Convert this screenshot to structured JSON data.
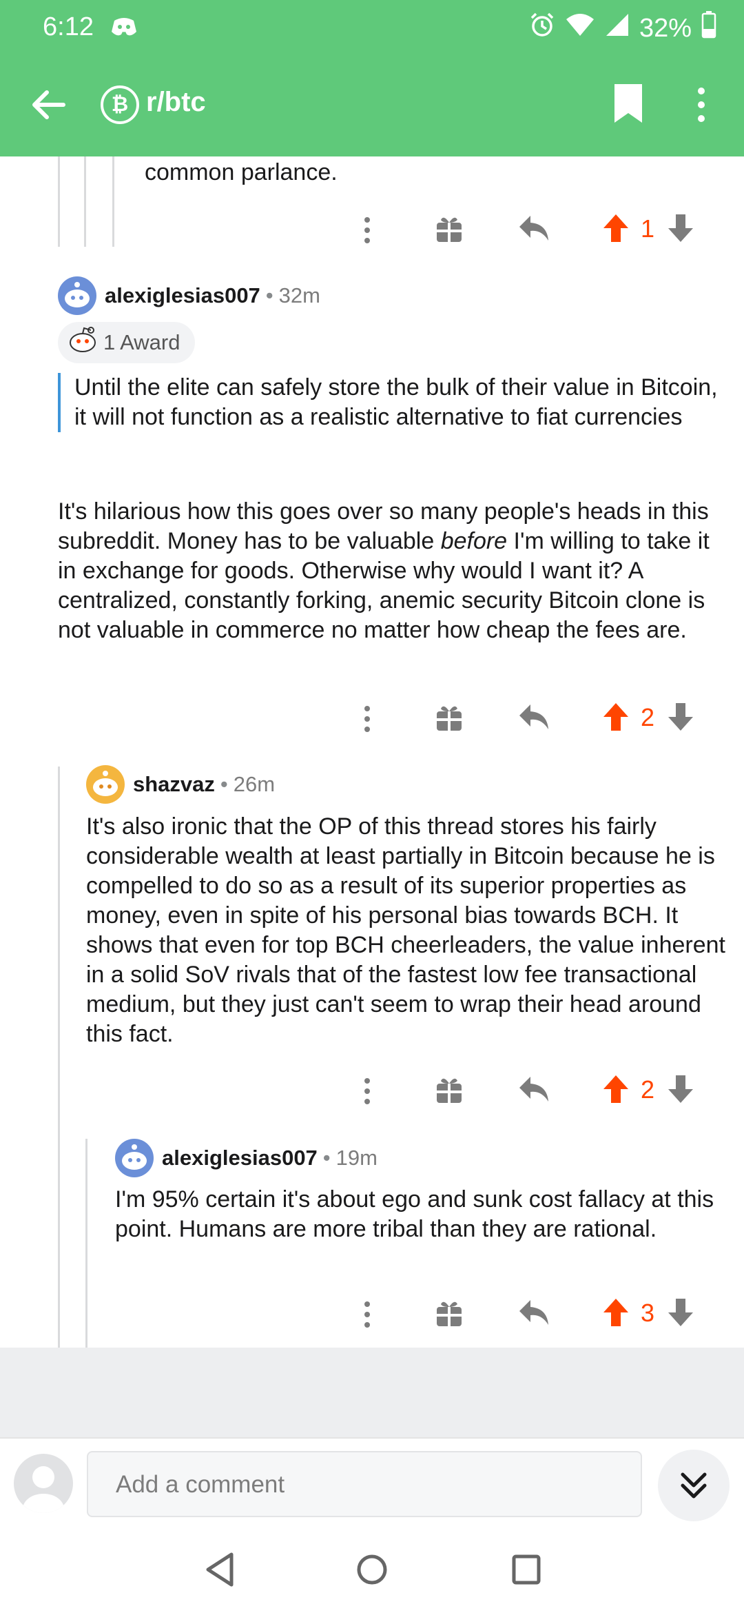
{
  "status_bar": {
    "time": "6:12",
    "battery": "32%"
  },
  "app_bar": {
    "subreddit": "r/btc"
  },
  "comments": [
    {
      "score": "1"
    },
    {
      "author": "alexiglesias007",
      "age": "32m",
      "award": "1 Award",
      "quote": "Until the elite can safely store the bulk of their value in Bitcoin, it will not function as a realistic alternative to fiat currencies",
      "body_part1": "It's hilarious how this goes over so many people's heads in this subreddit. Money has to be valuable ",
      "body_emphasis": "before",
      "body_part2": " I'm willing to take it in exchange for goods. Otherwise why would I want it? A centralized, constantly forking, anemic security Bitcoin clone is not valuable in commerce no matter how cheap the fees are.",
      "score": "2"
    },
    {
      "author": "shazvaz",
      "age": "26m",
      "body": "It's also ironic that the OP of this thread stores his fairly considerable wealth at least partially in Bitcoin because he is compelled to do so as a result of its superior properties as money, even in spite of his personal bias towards BCH. It shows that even for top BCH cheerleaders, the value inherent in a solid SoV rivals that of the fastest low fee transactional medium, but they just can't seem to wrap their head around this fact.",
      "score": "2"
    },
    {
      "author": "alexiglesias007",
      "age": "19m",
      "body": "I'm 95% certain it's about ego and sunk cost fallacy at this point. Humans are more tribal than they are rational.",
      "score": "3"
    }
  ],
  "partial_previous_text": "common parlance.",
  "composer": {
    "placeholder": "Add a comment"
  },
  "colors": {
    "header": "#5fc97a",
    "upvote": "#ff4500",
    "quote_bar": "#3e95d9"
  },
  "icons": [
    "discord-icon",
    "alarm-icon",
    "wifi-icon",
    "signal-icon",
    "battery-icon",
    "back-arrow-icon",
    "bitcoin-icon",
    "bookmark-icon",
    "more-vertical-icon",
    "gift-icon",
    "reply-icon",
    "upvote-icon",
    "downvote-icon",
    "chevron-double-down-icon",
    "nav-back-icon",
    "nav-home-icon",
    "nav-recents-icon"
  ]
}
